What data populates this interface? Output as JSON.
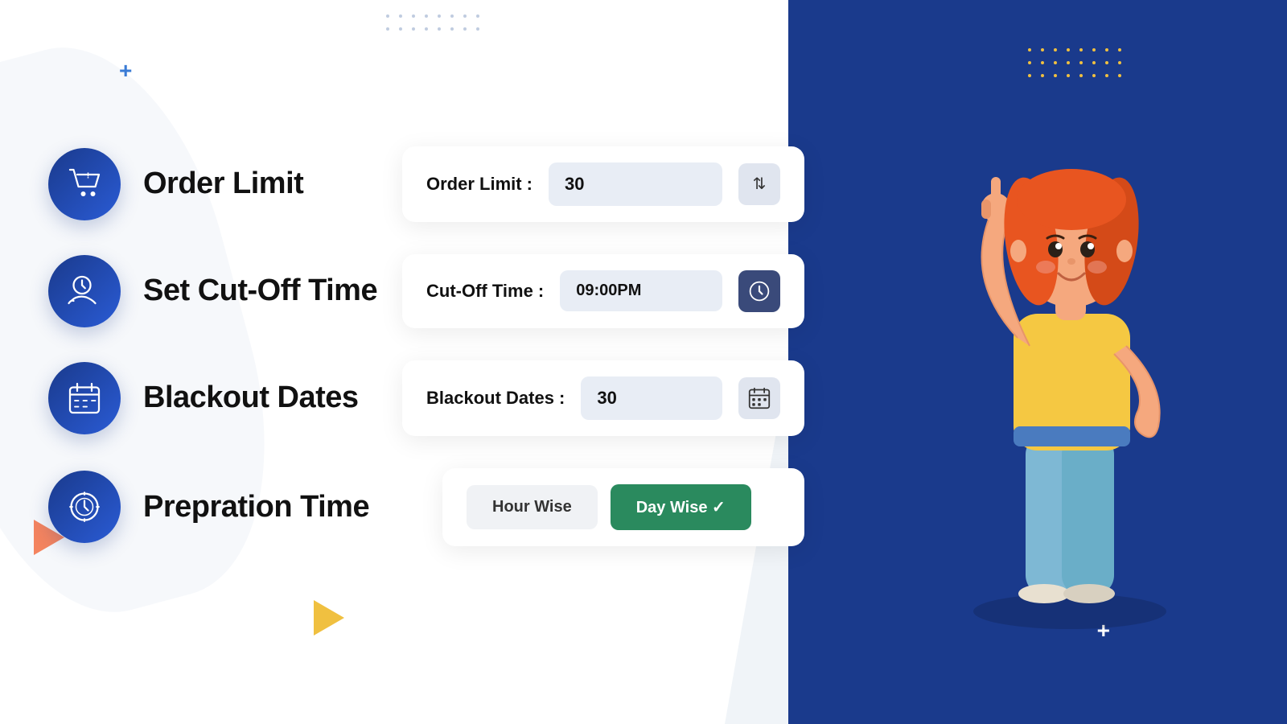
{
  "colors": {
    "blue_dark": "#1a3a8c",
    "blue_mid": "#2a5bd5",
    "green": "#2a8a5e",
    "accent_orange": "#f4845f",
    "accent_yellow": "#f0c040"
  },
  "decorations": {
    "plus_left": "+",
    "plus_right": "+"
  },
  "features": [
    {
      "id": "order-limit",
      "title": "Order Limit",
      "icon": "cart-icon",
      "panel_label": "Order Limit :",
      "panel_value": "30",
      "panel_icon": "spinner-icon"
    },
    {
      "id": "cut-off-time",
      "title": "Set Cut-Off Time",
      "icon": "clock-hand-icon",
      "panel_label": "Cut-Off Time :",
      "panel_value": "09:00PM",
      "panel_icon": "clock-icon"
    },
    {
      "id": "blackout-dates",
      "title": "Blackout Dates",
      "icon": "calendar-icon",
      "panel_label": "Blackout Dates :",
      "panel_value": "30",
      "panel_icon": "calendar-grid-icon"
    },
    {
      "id": "preparation-time",
      "title": "Prepration Time",
      "icon": "clock-circle-icon",
      "panel_type": "toggle",
      "btn_hour": "Hour Wise",
      "btn_day": "Day Wise ✓"
    }
  ]
}
